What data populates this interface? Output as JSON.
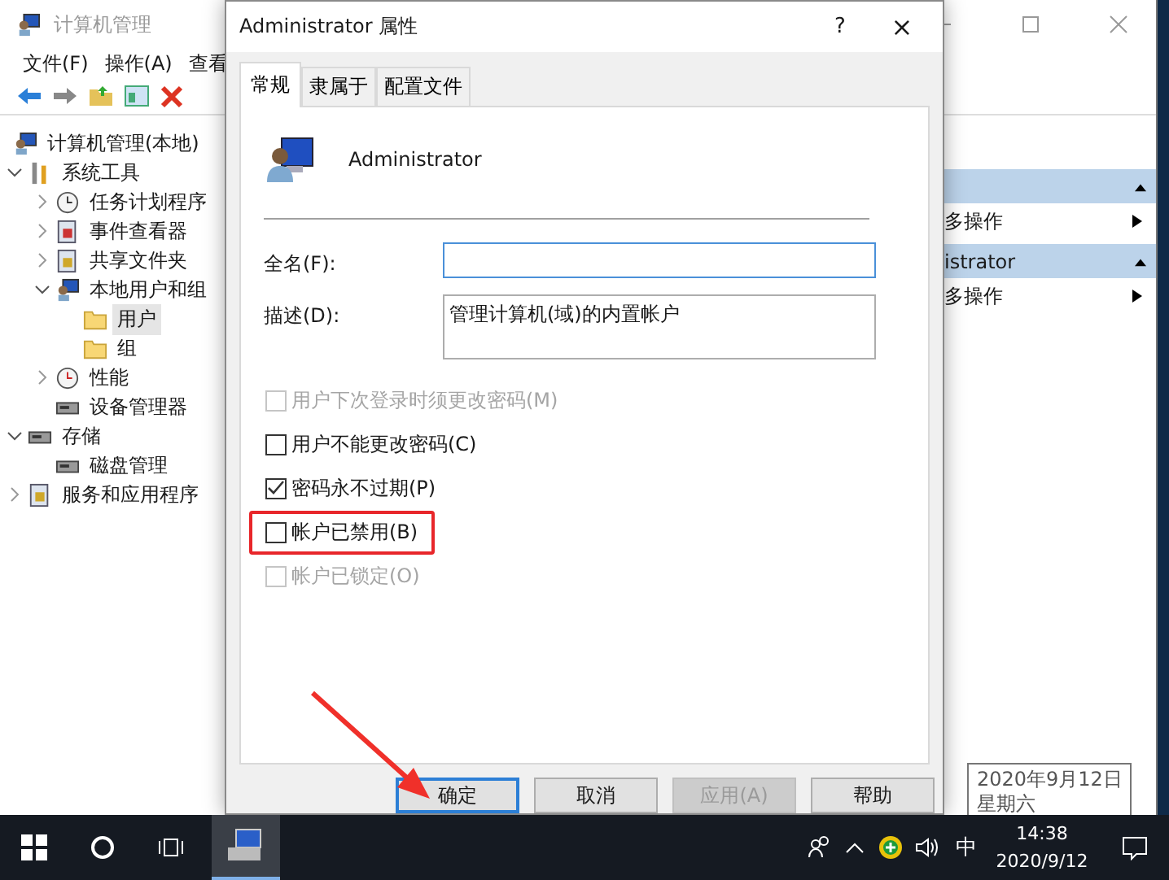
{
  "background_window": {
    "title": "计算机管理",
    "menu": [
      "文件(F)",
      "操作(A)",
      "查看"
    ],
    "tree": [
      {
        "label": "计算机管理(本地)",
        "kind": "computer",
        "selected": false,
        "children": [
          {
            "label": "系统工具",
            "kind": "tools",
            "expanded": true,
            "selected": false,
            "children": [
              {
                "label": "任务计划程序",
                "kind": "clock",
                "expanded": false,
                "selected": false
              },
              {
                "label": "事件查看器",
                "kind": "log",
                "expanded": false,
                "selected": false
              },
              {
                "label": "共享文件夹",
                "kind": "share",
                "expanded": false,
                "selected": false
              },
              {
                "label": "本地用户和组",
                "kind": "users",
                "expanded": true,
                "selected": false,
                "children": [
                  {
                    "label": "用户",
                    "kind": "folder",
                    "selected": true
                  },
                  {
                    "label": "组",
                    "kind": "folder",
                    "selected": false
                  }
                ]
              },
              {
                "label": "性能",
                "kind": "gauge",
                "expanded": false,
                "selected": false
              },
              {
                "label": "设备管理器",
                "kind": "device",
                "selected": false
              }
            ]
          },
          {
            "label": "存储",
            "kind": "storage",
            "expanded": true,
            "selected": false,
            "children": [
              {
                "label": "磁盘管理",
                "kind": "disk",
                "selected": false
              }
            ]
          },
          {
            "label": "服务和应用程序",
            "kind": "services",
            "expanded": false,
            "selected": false
          }
        ]
      }
    ],
    "actions": [
      {
        "kind": "header"
      },
      {
        "kind": "item",
        "label": "多操作"
      },
      {
        "kind": "header",
        "label": "istrator"
      },
      {
        "kind": "item",
        "label": "多操作"
      }
    ]
  },
  "dialog": {
    "title": "Administrator 属性",
    "help": "?",
    "close": "×",
    "tabs": [
      {
        "label": "常规",
        "selected": true
      },
      {
        "label": "隶属于",
        "selected": false
      },
      {
        "label": "配置文件",
        "selected": false
      }
    ],
    "user_name": "Administrator",
    "fields": [
      {
        "label": "全名(F):",
        "focused": true,
        "kind": "line"
      },
      {
        "label": "描述(D):",
        "value": "管理计算机(域)的内置帐户",
        "focused": false,
        "kind": "box"
      }
    ],
    "checkboxes": [
      {
        "label": "用户下次登录时须更改密码(M)",
        "checked": false,
        "disabled": true,
        "highlighted": false
      },
      {
        "label": "用户不能更改密码(C)",
        "checked": false,
        "disabled": false,
        "highlighted": false
      },
      {
        "label": "密码永不过期(P)",
        "checked": true,
        "disabled": false,
        "highlighted": false
      },
      {
        "label": "帐户已禁用(B)",
        "checked": false,
        "disabled": false,
        "highlighted": true
      },
      {
        "label": "帐户已锁定(O)",
        "checked": false,
        "disabled": true,
        "highlighted": false
      }
    ],
    "buttons": [
      {
        "label": "确定",
        "default": true,
        "disabled": false
      },
      {
        "label": "取消",
        "default": false,
        "disabled": false
      },
      {
        "label": "应用(A)",
        "default": false,
        "disabled": true
      },
      {
        "label": "帮助",
        "default": false,
        "disabled": false
      }
    ]
  },
  "tooltip": {
    "lines": [
      "2020年9月12日",
      "星期六"
    ]
  },
  "taskbar": {
    "input_method": "中",
    "time": "14:38",
    "date": "2020/9/12"
  }
}
